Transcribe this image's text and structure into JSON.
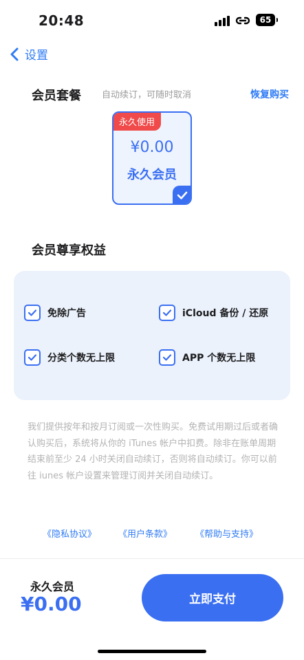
{
  "status_bar": {
    "time": "20:48",
    "battery": "65"
  },
  "nav": {
    "back_label": "设置"
  },
  "plans": {
    "title": "会员套餐",
    "subtitle": "自动续订，可随时取消",
    "restore_label": "恢复购买",
    "selected": {
      "badge": "永久使用",
      "price": "¥0.00",
      "name": "永久会员"
    }
  },
  "benefits": {
    "title": "会员尊享权益",
    "items": [
      {
        "label": "免除广告"
      },
      {
        "label": "iCloud 备份 / 还原"
      },
      {
        "label": "分类个数无上限"
      },
      {
        "label": "APP 个数无上限"
      }
    ]
  },
  "description": "我们提供按年和按月订阅或一次性购买。免费试用期过后或者确认购买后，系统将从你的 iTunes 帐户中扣费。除非在账单周期结束前至少 24 小时关闭自动续订，否则将自动续订。你可以前往 iunes 帐户设置来管理订阅并关闭自动续订。",
  "legal_links": {
    "privacy": "《隐私协议》",
    "terms": "《用户条款》",
    "help": "《帮助与支持》"
  },
  "footer": {
    "plan_name": "永久会员",
    "price": "¥0.00",
    "pay_label": "立即支付"
  },
  "colors": {
    "accent": "#3a6ff2",
    "link": "#2f7bf5",
    "badge": "#f04a4a",
    "panel": "#ebf2fc"
  }
}
